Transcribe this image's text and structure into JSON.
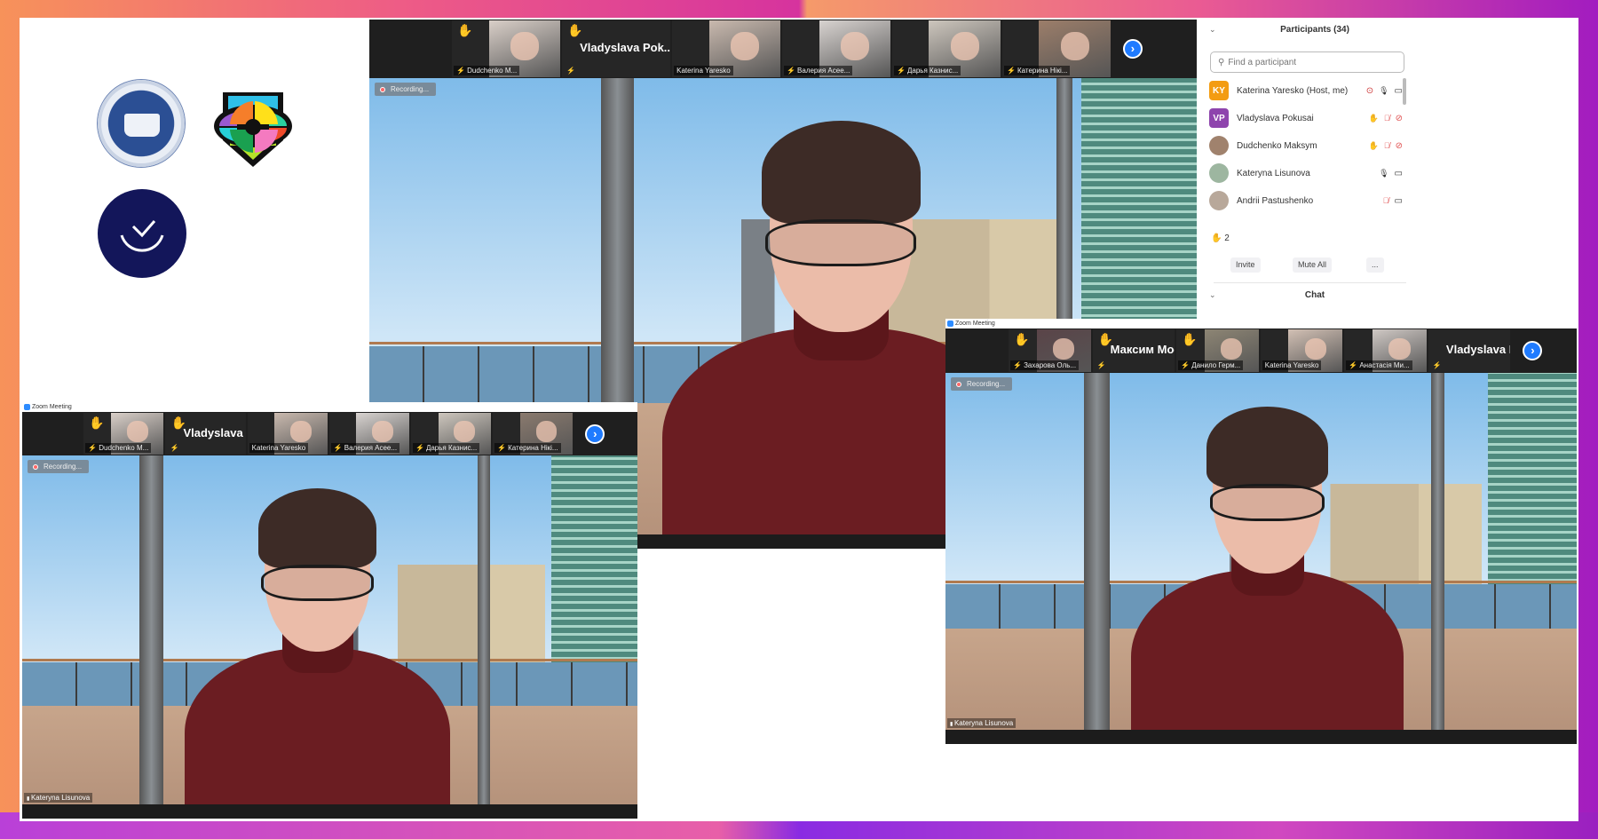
{
  "colors": {
    "accent": "#2d8cff",
    "host_avatar": "#f39c12",
    "vp_avatar": "#8e44ad",
    "muted": "#e05050",
    "logo_navy": "#13165a"
  },
  "logos": [
    "university-seal",
    "colorful-shield-logo",
    "navy-check-smile-logo"
  ],
  "participants": {
    "title": "Participants (34)",
    "search_placeholder": "Find a participant",
    "rows": [
      {
        "initials": "KY",
        "name": "Katerina Yaresko (Host, me)",
        "avatar": "#f39c12",
        "hand": false,
        "record": true,
        "mic": "on",
        "cam": "on"
      },
      {
        "initials": "VP",
        "name": "Vladyslava Pokusai",
        "avatar": "#8e44ad",
        "hand": true,
        "record": false,
        "mic": "off",
        "cam": "off"
      },
      {
        "initials": "",
        "name": "Dudchenko Maksym",
        "avatar": "#a0826d",
        "hand": true,
        "record": false,
        "mic": "off",
        "cam": "off"
      },
      {
        "initials": "",
        "name": "Kateryna Lisunova",
        "avatar": "#9db6a0",
        "hand": false,
        "record": false,
        "mic": "on",
        "cam": "on"
      },
      {
        "initials": "",
        "name": "Andrii Pastushenko",
        "avatar": "#b8a89a",
        "hand": false,
        "record": false,
        "mic": "off",
        "cam": "on"
      }
    ],
    "raised_hands": "2",
    "buttons": {
      "invite": "Invite",
      "mute_all": "Mute All",
      "more": "..."
    },
    "chat_title": "Chat"
  },
  "windows": [
    {
      "title": "",
      "recording": "Recording...",
      "speaker": "",
      "tiles": [
        {
          "name": "Dudchenko M...",
          "type": "video",
          "hand": true,
          "muted": true,
          "photo": "#d9cfc8"
        },
        {
          "name": "Vladyslava  Pok...",
          "type": "name",
          "hand": true,
          "muted": true
        },
        {
          "name": "Katerina Yaresko",
          "type": "video",
          "hand": false,
          "muted": false,
          "photo": "#c9b9ae"
        },
        {
          "name": "Валерия Асее...",
          "type": "video",
          "hand": false,
          "muted": true,
          "photo": "#d8d3d0"
        },
        {
          "name": "Дарья Казнис...",
          "type": "video",
          "hand": false,
          "muted": true,
          "photo": "#cdc6bd"
        },
        {
          "name": "Катерина Нікі...",
          "type": "video",
          "hand": false,
          "muted": true,
          "photo": "#9c7e6a"
        }
      ]
    },
    {
      "title": "Zoom Meeting",
      "recording": "Recording...",
      "speaker": "Kateryna Lisunova",
      "tiles": [
        {
          "name": "Dudchenko M...",
          "type": "video",
          "hand": true,
          "muted": true,
          "photo": "#d9cfc8"
        },
        {
          "name": "Vladyslava  Pok...",
          "type": "name",
          "hand": true,
          "muted": true
        },
        {
          "name": "Katerina Yaresko",
          "type": "video",
          "hand": false,
          "muted": false,
          "photo": "#c9b9ae"
        },
        {
          "name": "Валерия Асее...",
          "type": "video",
          "hand": false,
          "muted": true,
          "photo": "#d8d3d0"
        },
        {
          "name": "Дарья Казнис...",
          "type": "video",
          "hand": false,
          "muted": true,
          "photo": "#cdc6bd"
        },
        {
          "name": "Катерина Нікі...",
          "type": "video",
          "hand": false,
          "muted": true,
          "photo": "#8a7a6e"
        }
      ]
    },
    {
      "title": "Zoom Meeting",
      "recording": "Recording...",
      "speaker": "Kateryna Lisunova",
      "tiles": [
        {
          "name": "Захарова Оль...",
          "type": "video",
          "hand": true,
          "muted": true,
          "photo": "#5a4448"
        },
        {
          "name": "Максим  Мосен...",
          "type": "name",
          "hand": true,
          "muted": true
        },
        {
          "name": "Данило Герм...",
          "type": "video",
          "hand": true,
          "muted": true,
          "photo": "#8d8574"
        },
        {
          "name": "Katerina Yaresko",
          "type": "video",
          "hand": false,
          "muted": false,
          "photo": "#d2c0b4"
        },
        {
          "name": "Анастасія Ми...",
          "type": "video",
          "hand": false,
          "muted": true,
          "photo": "#cfc8c4"
        },
        {
          "name": "Vladyslava  Pok...",
          "type": "name",
          "hand": false,
          "muted": true
        }
      ]
    }
  ]
}
